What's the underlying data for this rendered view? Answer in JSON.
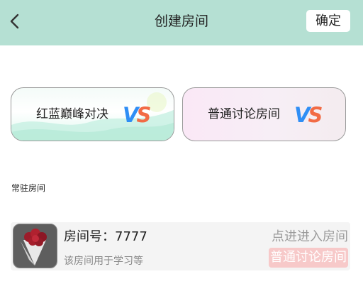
{
  "header": {
    "title": "创建房间",
    "back_icon": "chevron-left-icon",
    "confirm_label": "确定",
    "background": "#b5e0d3"
  },
  "modes": [
    {
      "label": "红蓝巅峰对决",
      "vs_v": "V",
      "vs_s": "S"
    },
    {
      "label": "普通讨论房间",
      "vs_v": "V",
      "vs_s": "S"
    }
  ],
  "section": {
    "title": "常驻房间"
  },
  "rooms": [
    {
      "number_label": "房间号：7777",
      "description": "该房间用于学习等",
      "enter_label": "点进进入房间",
      "type_label": "普通讨论房间"
    }
  ],
  "colors": {
    "vs_blue": "#2f8ef5",
    "vs_orange": "#f26b45",
    "badge_pink": "#f7c9c9"
  }
}
